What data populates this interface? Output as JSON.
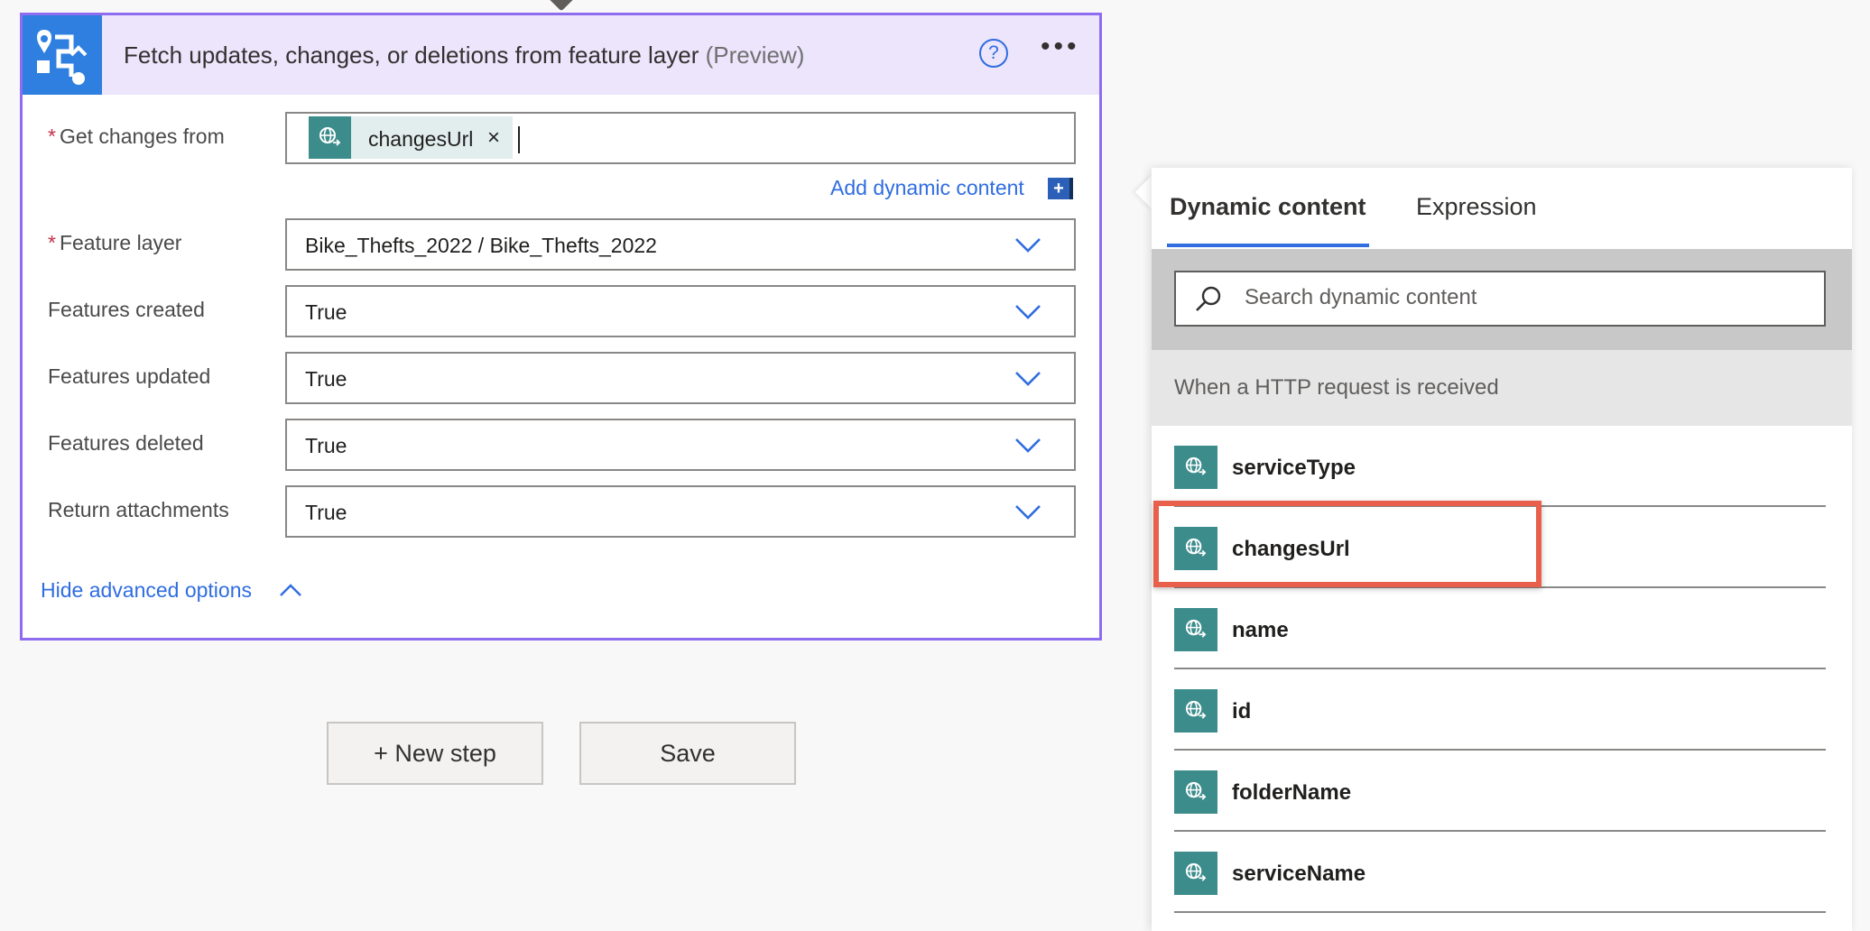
{
  "card": {
    "title": "Fetch updates, changes, or deletions from feature layer",
    "title_suffix": "(Preview)",
    "help_glyph": "?",
    "more_glyph": "•••"
  },
  "fields": {
    "get_changes": {
      "label": "Get changes from",
      "required": true,
      "token_label": "changesUrl",
      "token_close": "×"
    },
    "add_dynamic_content": "Add dynamic content",
    "add_dynamic_glyph": "+",
    "feature_layer": {
      "label": "Feature layer",
      "required": true,
      "value": "Bike_Thefts_2022 / Bike_Thefts_2022"
    },
    "features_created": {
      "label": "Features created",
      "value": "True"
    },
    "features_updated": {
      "label": "Features updated",
      "value": "True"
    },
    "features_deleted": {
      "label": "Features deleted",
      "value": "True"
    },
    "return_attachments": {
      "label": "Return attachments",
      "value": "True"
    },
    "required_marker": "*"
  },
  "hide_advanced": "Hide advanced options",
  "buttons": {
    "new_step": "+ New step",
    "save": "Save"
  },
  "panel": {
    "tabs": [
      "Dynamic content",
      "Expression"
    ],
    "search_placeholder": "Search dynamic content",
    "section_title": "When a HTTP request is received",
    "items": [
      "serviceType",
      "changesUrl",
      "name",
      "id",
      "folderName",
      "serviceName"
    ]
  },
  "colors": {
    "accent": "#2f6de0",
    "card_border": "#8e6cf0",
    "token_teal": "#3d8c8c",
    "highlight": "#e8604c"
  }
}
